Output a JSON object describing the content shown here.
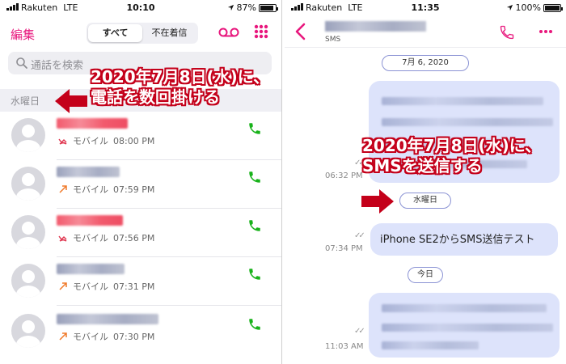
{
  "left": {
    "status": {
      "carrier": "Rakuten",
      "network": "LTE",
      "time": "10:10",
      "battery": "87%"
    },
    "edit_label": "編集",
    "segments": [
      {
        "label": "すべて",
        "active": true
      },
      {
        "label": "不在着信",
        "active": false
      }
    ],
    "search_placeholder": "通話を検索",
    "day_header": "水曜日",
    "calls": [
      {
        "type": "モバイル",
        "time": "08:00 PM",
        "direction": "missed",
        "name_color": "red"
      },
      {
        "type": "モバイル",
        "time": "07:59 PM",
        "direction": "outgoing",
        "name_color": "gray"
      },
      {
        "type": "モバイル",
        "time": "07:56 PM",
        "direction": "missed",
        "name_color": "red"
      },
      {
        "type": "モバイル",
        "time": "07:31 PM",
        "direction": "outgoing",
        "name_color": "gray"
      },
      {
        "type": "モバイル",
        "time": "07:30 PM",
        "direction": "outgoing",
        "name_color": "gray"
      }
    ],
    "annotation": [
      "2020年7月8日(水)に、",
      "電話を数回掛ける"
    ]
  },
  "right": {
    "status": {
      "carrier": "Rakuten",
      "network": "LTE",
      "time": "11:35",
      "battery": "100%"
    },
    "channel_label": "SMS",
    "date_pill_1": "7月 6, 2020",
    "date_pill_2": "水曜日",
    "date_pill_3": "今日",
    "message_times": [
      "06:32 PM",
      "07:34 PM",
      "11:03 AM"
    ],
    "visible_message": "iPhone SE2からSMS送信テスト",
    "annotation": [
      "2020年7月8日(水)に、",
      "SMSを送信する"
    ]
  },
  "colors": {
    "accent": "#e8177d",
    "call_green": "#18b21a",
    "annotation_red": "#c4001a",
    "bubble": "#dde3fb"
  }
}
